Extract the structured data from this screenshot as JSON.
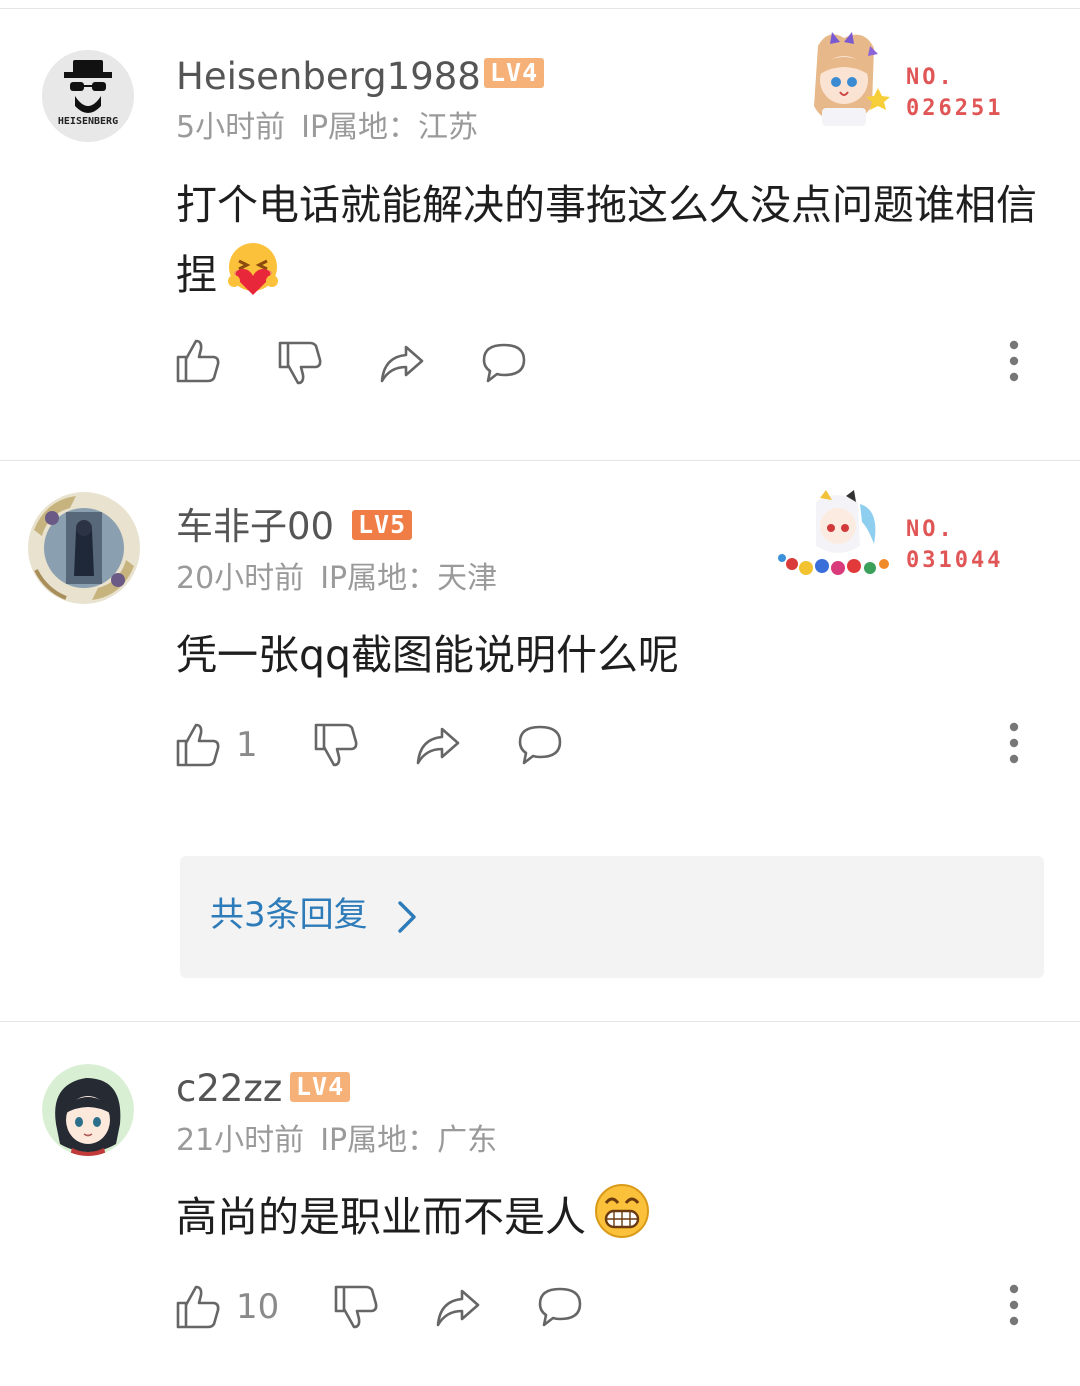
{
  "colors": {
    "lv4": "#f6b179",
    "lv5": "#f07d45",
    "badge_red": "#e05656",
    "reply_link": "#2d7bb8"
  },
  "comments": [
    {
      "username": "Heisenberg1988",
      "level": "LV4",
      "time": "5小时前",
      "ip": "IP属地：江苏",
      "avatar_text": "HEISENBERG",
      "text": "打个电话就能解决的事拖这么久没点问题谁相信捏",
      "emoji": "hug-heart-emoji",
      "badge_no_label": "NO.",
      "badge_no_value": "026251",
      "likes": ""
    },
    {
      "username": "车非子00",
      "level": "LV5",
      "time": "20小时前",
      "ip": "IP属地：天津",
      "text": "凭一张qq截图能说明什么呢",
      "badge_no_label": "NO.",
      "badge_no_value": "031044",
      "likes": "1",
      "replies_label": "共3条回复"
    },
    {
      "username": "c22zz",
      "level": "LV4",
      "time": "21小时前",
      "ip": "IP属地：广东",
      "text": "高尚的是职业而不是人",
      "emoji": "grin-emoji",
      "likes": "10"
    }
  ]
}
